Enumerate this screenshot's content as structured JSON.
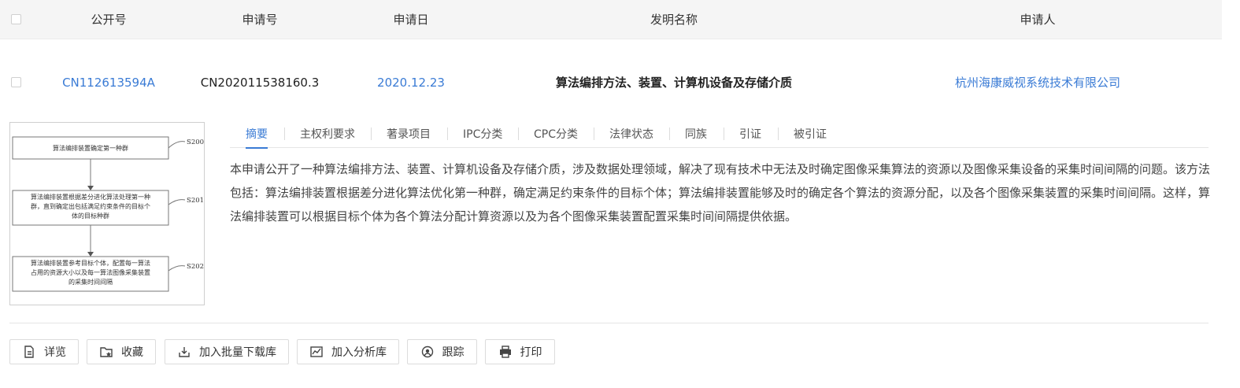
{
  "header": {
    "pub_no": "公开号",
    "app_no": "申请号",
    "app_date": "申请日",
    "title": "发明名称",
    "applicant": "申请人"
  },
  "row": {
    "pub_no": "CN112613594A",
    "app_no": "CN202011538160.3",
    "app_date": "2020.12.23",
    "title": "算法编排方法、装置、计算机设备及存储介质",
    "applicant": "杭州海康威视系统技术有限公司"
  },
  "figure": {
    "steps": [
      {
        "id": "S200",
        "lines": [
          "算法编排装置确定第一种群"
        ]
      },
      {
        "id": "S201",
        "lines": [
          "算法编排装置根据差分进化算法处理第一种",
          "群，直到确定出包括满足约束条件的目标个",
          "体的目标种群"
        ]
      },
      {
        "id": "S202",
        "lines": [
          "算法编排装置参考目标个体，配置每一算法",
          "占用的资源大小以及每一算法图像采集装置",
          "的采集时间间隔"
        ]
      }
    ]
  },
  "tabs": [
    "摘要",
    "主权利要求",
    "著录项目",
    "IPC分类",
    "CPC分类",
    "法律状态",
    "同族",
    "引证",
    "被引证"
  ],
  "abstract": "本申请公开了一种算法编排方法、装置、计算机设备及存储介质，涉及数据处理领域，解决了现有技术中无法及时确定图像采集算法的资源以及图像采集设备的采集时间间隔的问题。该方法包括：算法编排装置根据差分进化算法优化第一种群，确定满足约束条件的目标个体；算法编排装置能够及时的确定各个算法的资源分配，以及各个图像采集装置的采集时间间隔。这样，算法编排装置可以根据目标个体为各个算法分配计算资源以及为各个图像采集装置配置采集时间间隔提供依据。",
  "actions": {
    "detail": "详览",
    "favorite": "收藏",
    "batch_download": "加入批量下载库",
    "analysis": "加入分析库",
    "track": "跟踪",
    "print": "打印"
  },
  "colors": {
    "link": "#3a7bd5",
    "header_bg": "#f5f5f5"
  }
}
